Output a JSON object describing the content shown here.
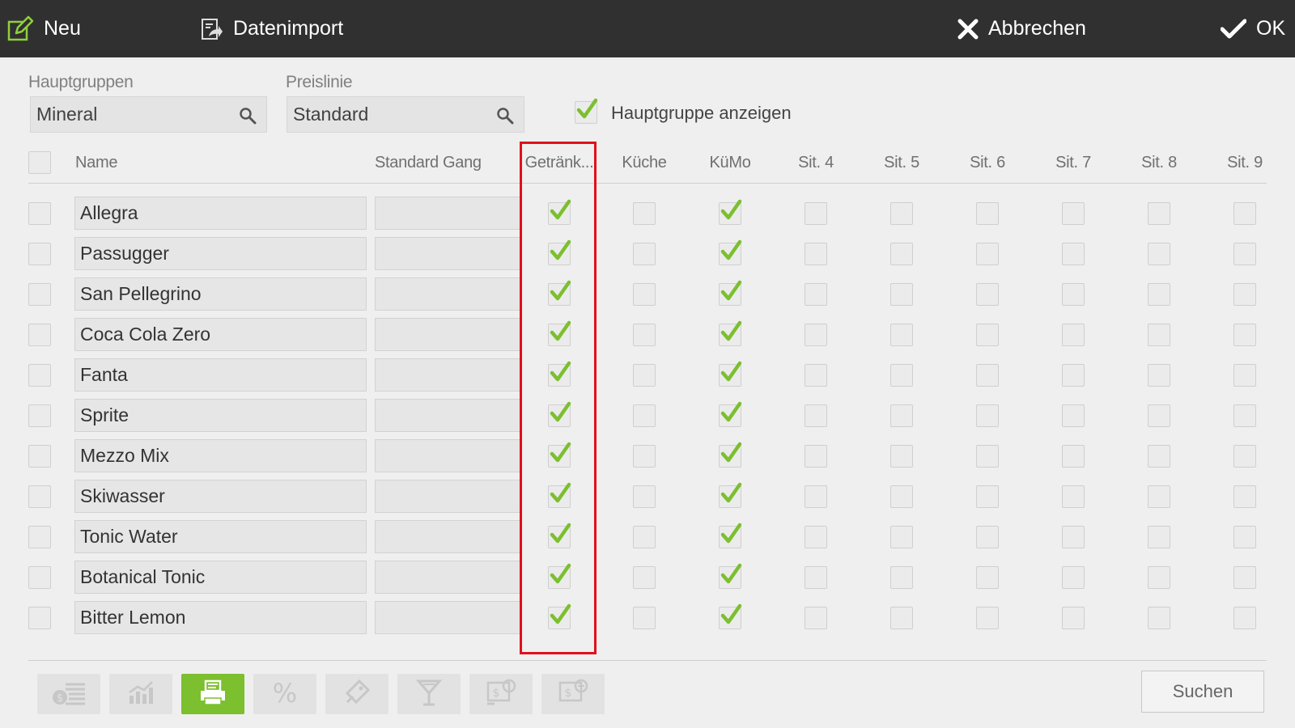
{
  "toolbar": {
    "new_label": "Neu",
    "import_label": "Datenimport",
    "cancel_label": "Abbrechen",
    "ok_label": "OK"
  },
  "filters": {
    "hauptgruppen_label": "Hauptgruppen",
    "hauptgruppen_value": "Mineral",
    "preislinie_label": "Preislinie",
    "preislinie_value": "Standard",
    "show_group_label": "Hauptgruppe anzeigen",
    "show_group_checked": true
  },
  "table": {
    "columns": [
      "Name",
      "Standard Gang",
      "Getränk...",
      "Küche",
      "KüMo",
      "Sit. 4",
      "Sit. 5",
      "Sit. 6",
      "Sit. 7",
      "Sit. 8",
      "Sit. 9"
    ],
    "rows": [
      {
        "name": "Allegra",
        "gang": "",
        "flags": [
          true,
          false,
          true,
          false,
          false,
          false,
          false,
          false,
          false
        ]
      },
      {
        "name": "Passugger",
        "gang": "",
        "flags": [
          true,
          false,
          true,
          false,
          false,
          false,
          false,
          false,
          false
        ]
      },
      {
        "name": "San Pellegrino",
        "gang": "",
        "flags": [
          true,
          false,
          true,
          false,
          false,
          false,
          false,
          false,
          false
        ]
      },
      {
        "name": "Coca Cola Zero",
        "gang": "",
        "flags": [
          true,
          false,
          true,
          false,
          false,
          false,
          false,
          false,
          false
        ]
      },
      {
        "name": "Fanta",
        "gang": "",
        "flags": [
          true,
          false,
          true,
          false,
          false,
          false,
          false,
          false,
          false
        ]
      },
      {
        "name": "Sprite",
        "gang": "",
        "flags": [
          true,
          false,
          true,
          false,
          false,
          false,
          false,
          false,
          false
        ]
      },
      {
        "name": "Mezzo Mix",
        "gang": "",
        "flags": [
          true,
          false,
          true,
          false,
          false,
          false,
          false,
          false,
          false
        ]
      },
      {
        "name": "Skiwasser",
        "gang": "",
        "flags": [
          true,
          false,
          true,
          false,
          false,
          false,
          false,
          false,
          false
        ]
      },
      {
        "name": "Tonic Water",
        "gang": "",
        "flags": [
          true,
          false,
          true,
          false,
          false,
          false,
          false,
          false,
          false
        ]
      },
      {
        "name": "Botanical Tonic",
        "gang": "",
        "flags": [
          true,
          false,
          true,
          false,
          false,
          false,
          false,
          false,
          false
        ]
      },
      {
        "name": "Bitter Lemon",
        "gang": "",
        "flags": [
          true,
          false,
          true,
          false,
          false,
          false,
          false,
          false,
          false
        ]
      }
    ]
  },
  "bottom": {
    "tools": [
      {
        "icon": "price-list-icon",
        "active": false
      },
      {
        "icon": "statistics-icon",
        "active": false
      },
      {
        "icon": "printer-icon",
        "active": true
      },
      {
        "icon": "percent-icon",
        "active": false
      },
      {
        "icon": "tag-icon",
        "active": false
      },
      {
        "icon": "cocktail-icon",
        "active": false
      },
      {
        "icon": "money-settings-icon",
        "active": false
      },
      {
        "icon": "money-settings-alt-icon",
        "active": false
      }
    ],
    "search_label": "Suchen"
  },
  "colors": {
    "topbar": "#303030",
    "check_green": "#7cbf2f",
    "highlight_red": "#e0101a"
  }
}
